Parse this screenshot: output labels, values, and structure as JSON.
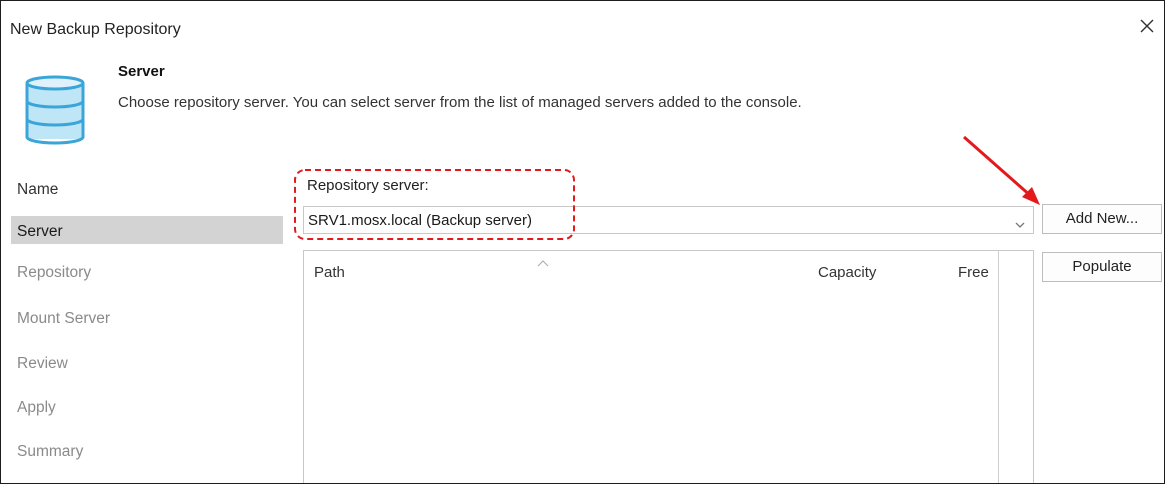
{
  "window": {
    "title": "New Backup Repository"
  },
  "header": {
    "title": "Server",
    "description": "Choose repository server. You can select server from the list of managed servers added to the console."
  },
  "nav": {
    "items": [
      {
        "label": "Name",
        "state": "done"
      },
      {
        "label": "Server",
        "state": "active"
      },
      {
        "label": "Repository",
        "state": "pending"
      },
      {
        "label": "Mount Server",
        "state": "pending"
      },
      {
        "label": "Review",
        "state": "pending"
      },
      {
        "label": "Apply",
        "state": "pending"
      },
      {
        "label": "Summary",
        "state": "pending"
      }
    ]
  },
  "form": {
    "repository_server_label": "Repository server:",
    "repository_server_value": "SRV1.mosx.local (Backup server)"
  },
  "buttons": {
    "add_new": "Add New...",
    "populate": "Populate"
  },
  "grid": {
    "columns": [
      "Path",
      "Capacity",
      "Free"
    ],
    "rows": []
  },
  "annotation": {
    "color": "#e3191c"
  },
  "colors": {
    "active_nav_bg": "#d3d3d3",
    "icon_blue": "#bfe6f7",
    "icon_outline": "#3aa5d8"
  }
}
